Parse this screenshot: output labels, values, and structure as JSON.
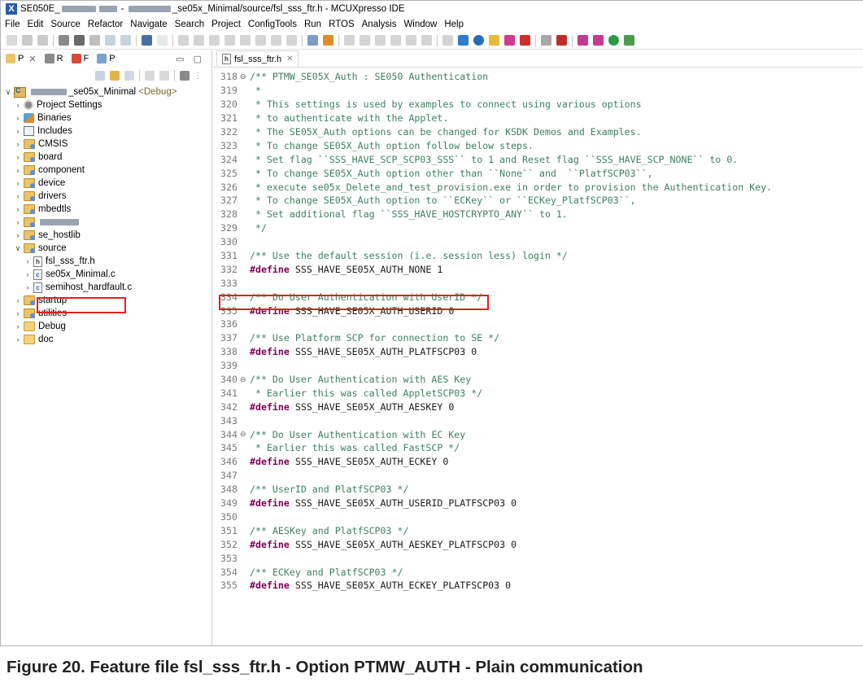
{
  "window": {
    "title_prefix": "SE050E_",
    "title_main": "_se05x_Minimal/source/fsl_sss_ftr.h - MCUXpresso IDE"
  },
  "menu": [
    "File",
    "Edit",
    "Source",
    "Refactor",
    "Navigate",
    "Search",
    "Project",
    "ConfigTools",
    "Run",
    "RTOS",
    "Analysis",
    "Window",
    "Help"
  ],
  "left_panel": {
    "tabs": [
      {
        "label": "P"
      },
      {
        "label": "R"
      },
      {
        "label": "F"
      },
      {
        "label": "P"
      }
    ],
    "project": {
      "name": "_se05x_Minimal",
      "config": "<Debug>"
    },
    "tree": [
      {
        "label": "Project Settings",
        "icon": "gear-icon"
      },
      {
        "label": "Binaries",
        "icon": "binaries-icon"
      },
      {
        "label": "Includes",
        "icon": "includes-icon"
      },
      {
        "label": "CMSIS",
        "icon": "source-folder-icon"
      },
      {
        "label": "board",
        "icon": "source-folder-icon"
      },
      {
        "label": "component",
        "icon": "source-folder-icon"
      },
      {
        "label": "device",
        "icon": "source-folder-icon"
      },
      {
        "label": "drivers",
        "icon": "source-folder-icon"
      },
      {
        "label": "mbedtls",
        "icon": "source-folder-icon"
      },
      {
        "label": "",
        "icon": "source-folder-icon"
      },
      {
        "label": "se_hostlib",
        "icon": "source-folder-icon"
      },
      {
        "label": "source",
        "icon": "source-folder-icon"
      },
      {
        "label": "fsl_sss_ftr.h",
        "icon": "header-file-icon"
      },
      {
        "label": "se05x_Minimal.c",
        "icon": "c-file-icon"
      },
      {
        "label": "semihost_hardfault.c",
        "icon": "c-file-icon"
      },
      {
        "label": "startup",
        "icon": "source-folder-icon"
      },
      {
        "label": "utilities",
        "icon": "source-folder-icon"
      },
      {
        "label": "Debug",
        "icon": "folder-icon"
      },
      {
        "label": "doc",
        "icon": "folder-icon"
      }
    ]
  },
  "editor": {
    "tab_label": "fsl_sss_ftr.h",
    "lines": [
      {
        "n": "318",
        "fold": "⊖",
        "text": "/** PTMW_SE05X_Auth : SE050 Authentication",
        "kind": "comment"
      },
      {
        "n": "319",
        "text": " *",
        "kind": "comment"
      },
      {
        "n": "320",
        "text": " * This settings is used by examples to connect using various options",
        "kind": "comment"
      },
      {
        "n": "321",
        "text": " * to authenticate with the Applet.",
        "kind": "comment"
      },
      {
        "n": "322",
        "text": " * The SE05X_Auth options can be changed for KSDK Demos and Examples.",
        "kind": "comment"
      },
      {
        "n": "323",
        "text": " * To change SE05X_Auth option follow below steps.",
        "kind": "comment"
      },
      {
        "n": "324",
        "text": " * Set flag ``SSS_HAVE_SCP_SCP03_SSS`` to 1 and Reset flag ``SSS_HAVE_SCP_NONE`` to 0.",
        "kind": "comment"
      },
      {
        "n": "325",
        "text": " * To change SE05X_Auth option other than ``None`` and  ``PlatfSCP03``,",
        "kind": "comment"
      },
      {
        "n": "326",
        "text": " * execute se05x_Delete_and_test_provision.exe in order to provision the Authentication Key.",
        "kind": "comment"
      },
      {
        "n": "327",
        "text": " * To change SE05X_Auth option to ``ECKey`` or ``ECKey_PlatfSCP03``,",
        "kind": "comment"
      },
      {
        "n": "328",
        "text": " * Set additional flag ``SSS_HAVE_HOSTCRYPTO_ANY`` to 1.",
        "kind": "comment"
      },
      {
        "n": "329",
        "text": " */",
        "kind": "comment"
      },
      {
        "n": "330",
        "text": "",
        "kind": "blank"
      },
      {
        "n": "331",
        "text": "/** Use the default session (i.e. session less) login */",
        "kind": "comment"
      },
      {
        "n": "332",
        "kw": "#define",
        "text": " SSS_HAVE_SE05X_AUTH_NONE 1",
        "kind": "define"
      },
      {
        "n": "333",
        "text": "",
        "kind": "blank"
      },
      {
        "n": "334",
        "text": "/** Do User Authentication with UserID */",
        "kind": "comment"
      },
      {
        "n": "335",
        "kw": "#define",
        "text": " SSS_HAVE_SE05X_AUTH_USERID 0",
        "kind": "define"
      },
      {
        "n": "336",
        "text": "",
        "kind": "blank"
      },
      {
        "n": "337",
        "text": "/** Use Platform SCP for connection to SE */",
        "kind": "comment"
      },
      {
        "n": "338",
        "kw": "#define",
        "text": " SSS_HAVE_SE05X_AUTH_PLATFSCP03 0",
        "kind": "define"
      },
      {
        "n": "339",
        "text": "",
        "kind": "blank"
      },
      {
        "n": "340",
        "fold": "⊖",
        "text": "/** Do User Authentication with AES Key",
        "kind": "comment"
      },
      {
        "n": "341",
        "text": " * Earlier this was called AppletSCP03 */",
        "kind": "comment"
      },
      {
        "n": "342",
        "kw": "#define",
        "text": " SSS_HAVE_SE05X_AUTH_AESKEY 0",
        "kind": "define"
      },
      {
        "n": "343",
        "text": "",
        "kind": "blank"
      },
      {
        "n": "344",
        "fold": "⊖",
        "text": "/** Do User Authentication with EC Key",
        "kind": "comment"
      },
      {
        "n": "345",
        "text": " * Earlier this was called FastSCP */",
        "kind": "comment"
      },
      {
        "n": "346",
        "kw": "#define",
        "text": " SSS_HAVE_SE05X_AUTH_ECKEY 0",
        "kind": "define"
      },
      {
        "n": "347",
        "text": "",
        "kind": "blank"
      },
      {
        "n": "348",
        "text": "/** UserID and PlatfSCP03 */",
        "kind": "comment"
      },
      {
        "n": "349",
        "kw": "#define",
        "text": " SSS_HAVE_SE05X_AUTH_USERID_PLATFSCP03 0",
        "kind": "define"
      },
      {
        "n": "350",
        "text": "",
        "kind": "blank"
      },
      {
        "n": "351",
        "text": "/** AESKey and PlatfSCP03 */",
        "kind": "comment"
      },
      {
        "n": "352",
        "kw": "#define",
        "text": " SSS_HAVE_SE05X_AUTH_AESKEY_PLATFSCP03 0",
        "kind": "define"
      },
      {
        "n": "353",
        "text": "",
        "kind": "blank"
      },
      {
        "n": "354",
        "text": "/** ECKey and PlatfSCP03 */",
        "kind": "comment"
      },
      {
        "n": "355",
        "kw": "#define",
        "text": " SSS_HAVE_SE05X_AUTH_ECKEY_PLATFSCP03 0",
        "kind": "define"
      }
    ]
  },
  "caption": "Figure 20.   Feature file fsl_sss_ftr.h - Option PTMW_AUTH - Plain communication",
  "colors": {
    "highlight": "#e02020",
    "comment": "#3f7f5f",
    "keyword": "#7f0055"
  }
}
